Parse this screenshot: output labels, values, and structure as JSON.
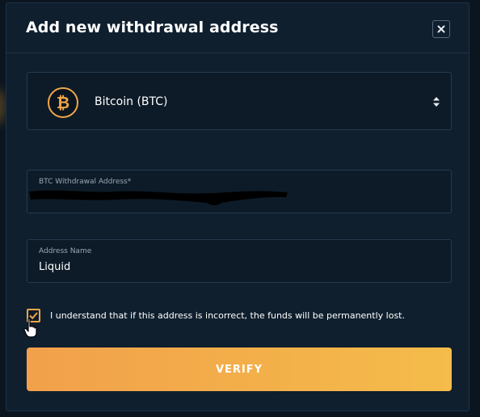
{
  "modal": {
    "title": "Add new withdrawal address"
  },
  "currency": {
    "label": "Bitcoin (BTC)",
    "coin_symbol": "₿",
    "icon": "bitcoin-icon",
    "accent_color": "#f0a64a"
  },
  "address_field": {
    "label": "BTC Withdrawal Address*",
    "value_redacted": true
  },
  "name_field": {
    "label": "Address Name",
    "value": "Liquid"
  },
  "consent": {
    "checked": true,
    "text": "I understand that if this address is incorrect, the funds will be permanently lost."
  },
  "verify_button": {
    "label": "VERIFY",
    "gradient_start": "#f2a04b",
    "gradient_end": "#f4bc4a"
  },
  "icons": {
    "close": "close-icon",
    "select_arrows": "select-arrows-icon",
    "checkmark": "checkmark-icon",
    "cursor": "hand-pointer-icon"
  }
}
